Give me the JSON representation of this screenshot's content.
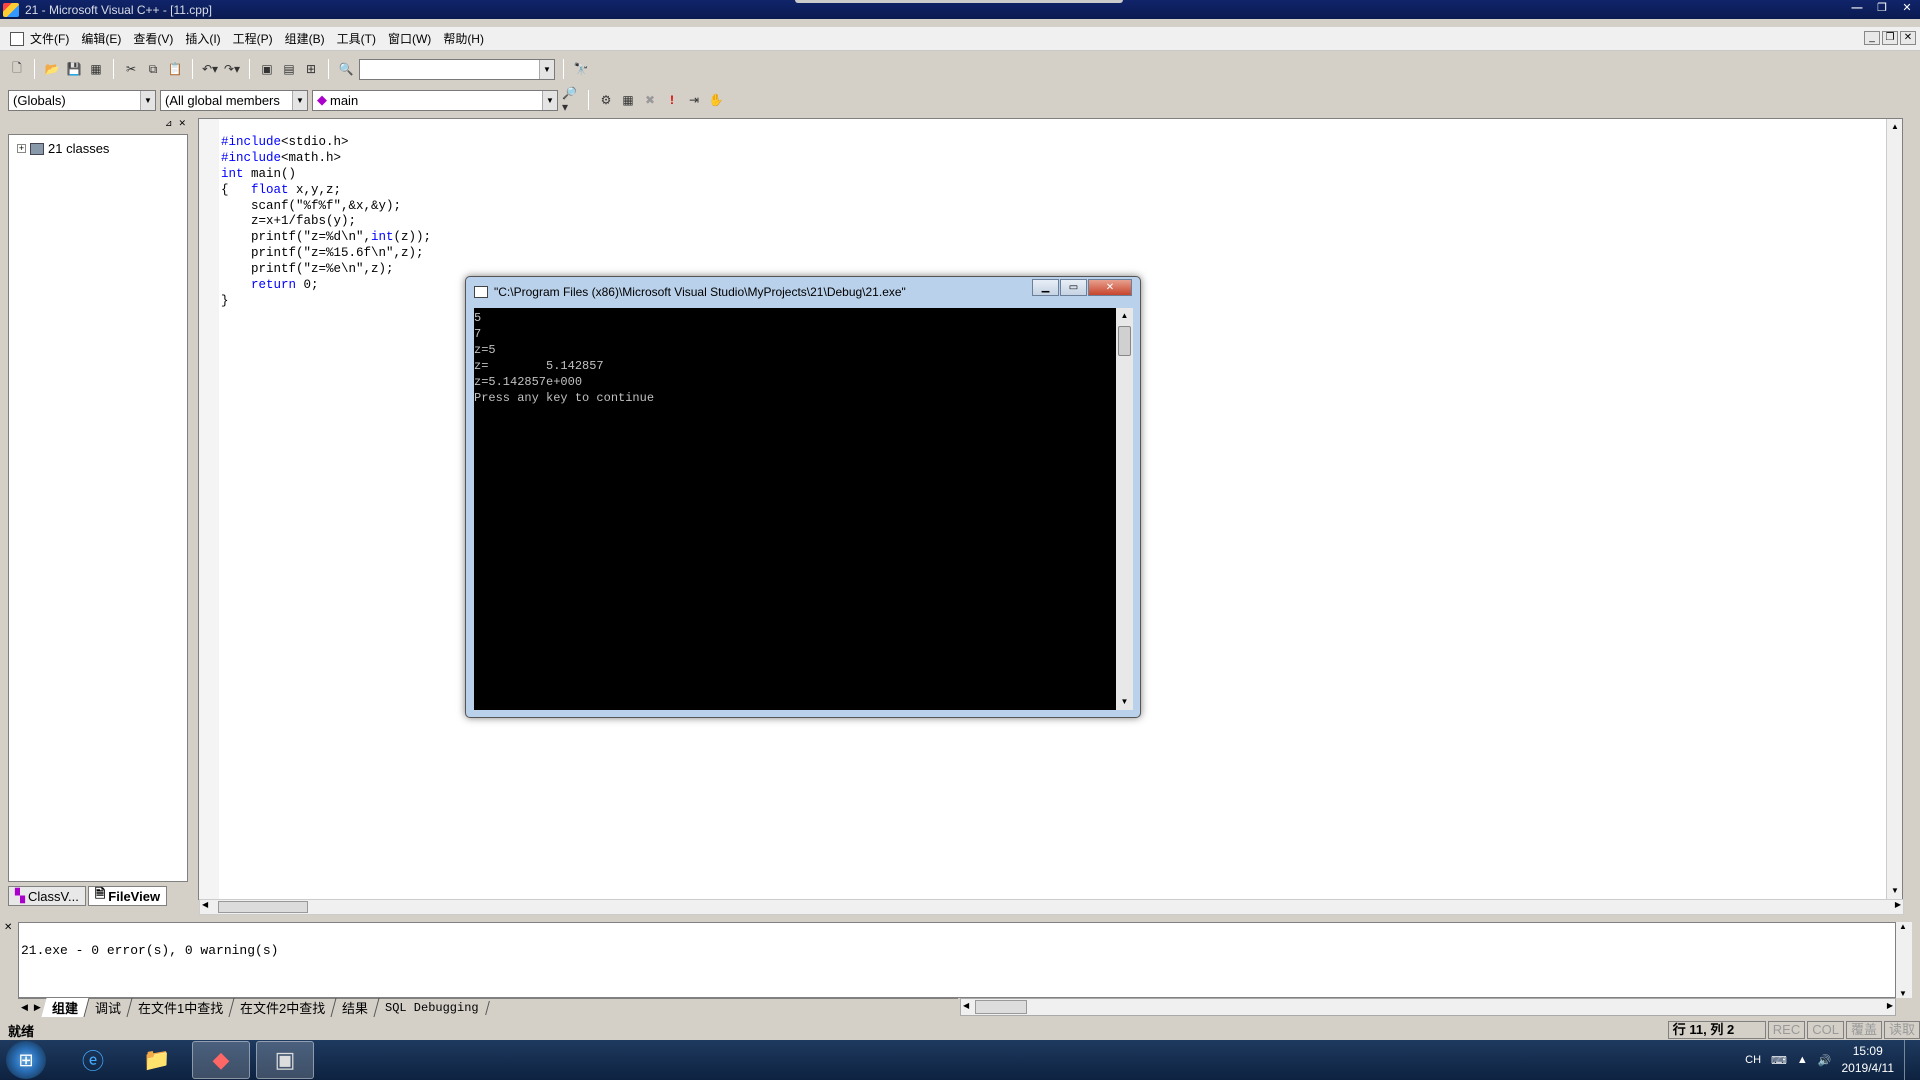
{
  "window": {
    "title": "21 - Microsoft Visual C++ - [11.cpp]",
    "controls": [
      "—",
      "❐",
      "✕"
    ]
  },
  "menu": {
    "items": [
      "文件(F)",
      "编辑(E)",
      "查看(V)",
      "插入(I)",
      "工程(P)",
      "组建(B)",
      "工具(T)",
      "窗口(W)",
      "帮助(H)"
    ]
  },
  "toolbar": {
    "find_combo_value": "",
    "globals_combo": "(Globals)",
    "members_combo": "(All global members",
    "function_combo": "main"
  },
  "workspace": {
    "tree_root": "21 classes",
    "tabs": [
      "ClassV...",
      "FileView"
    ]
  },
  "editor": {
    "lines": [
      "#include<stdio.h>",
      "#include<math.h>",
      "int main()",
      "{   float x,y,z;",
      "    scanf(\"%f%f\",&x,&y);",
      "    z=x+1/fabs(y);",
      "    printf(\"z=%d\\n\",int(z));",
      "    printf(\"z=%15.6f\\n\",z);",
      "    printf(\"z=%e\\n\",z);",
      "    return 0;",
      "}"
    ]
  },
  "console": {
    "title": "\"C:\\Program Files (x86)\\Microsoft Visual Studio\\MyProjects\\21\\Debug\\21.exe\"",
    "output": [
      "5",
      "7",
      "z=5",
      "z=        5.142857",
      "z=5.142857e+000",
      "Press any key to continue"
    ]
  },
  "output_pane": {
    "message": "21.exe - 0 error(s), 0 warning(s)",
    "tabs": [
      "组建",
      "调试",
      "在文件1中查找",
      "在文件2中查找",
      "结果",
      "SQL Debugging"
    ]
  },
  "statusbar": {
    "left": "就绪",
    "position": "行 11, 列 2",
    "indicators": [
      "REC",
      "COL",
      "覆盖",
      "读取"
    ]
  },
  "taskbar": {
    "ime": "CH",
    "time": "15:09",
    "date": "2019/4/11"
  },
  "colors": {
    "keyword": "#0000ff",
    "titlebar": "#10246a",
    "console_bg": "#000000"
  }
}
